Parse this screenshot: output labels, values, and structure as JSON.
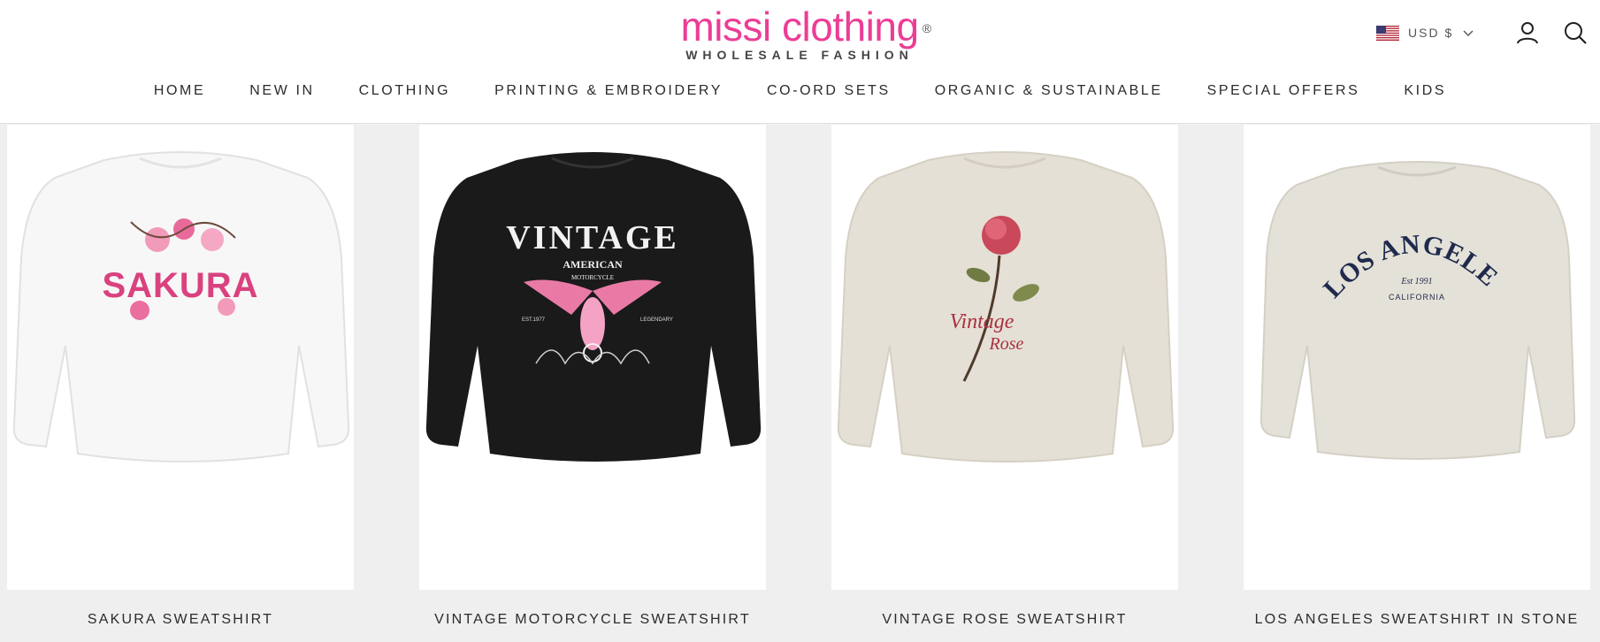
{
  "header": {
    "logo_text": "missi clothing",
    "logo_registered": "®",
    "logo_tagline": "WHOLESALE FASHION",
    "currency": "USD $",
    "icons": {
      "flag": "us-flag-icon",
      "chevron": "chevron-down-icon",
      "account": "user-icon",
      "search": "search-icon"
    }
  },
  "nav": {
    "items": [
      {
        "label": "HOME"
      },
      {
        "label": "NEW IN"
      },
      {
        "label": "CLOTHING"
      },
      {
        "label": "PRINTING & EMBROIDERY"
      },
      {
        "label": "CO-ORD SETS"
      },
      {
        "label": "ORGANIC & SUSTAINABLE"
      },
      {
        "label": "SPECIAL OFFERS"
      },
      {
        "label": "KIDS"
      }
    ]
  },
  "products": [
    {
      "title": "SAKURA SWEATSHIRT",
      "garment_color": "#f7f7f7",
      "print_main": "SAKURA",
      "print_sub": ""
    },
    {
      "title": "VINTAGE MOTORCYCLE SWEATSHIRT",
      "garment_color": "#1a1a1a",
      "print_main": "VINTAGE",
      "print_sub": "AMERICAN",
      "print_sub2": "MOTORCYCLE",
      "print_small_left": "EST.1977",
      "print_small_right": "LEGENDARY"
    },
    {
      "title": "VINTAGE ROSE SWEATSHIRT",
      "garment_color": "#e5e0d6",
      "print_main": "Vintage",
      "print_sub": "Rose"
    },
    {
      "title": "LOS ANGELES SWEATSHIRT IN STONE",
      "garment_color": "#e4e1d8",
      "print_main": "LOS ANGELES",
      "print_sub": "Est 1991",
      "print_sub2": "CALIFORNIA"
    }
  ],
  "colors": {
    "brand_pink": "#ec3d96",
    "page_bg": "#efefef",
    "navy_print": "#1f2a4d",
    "rose_red": "#a8323f"
  }
}
